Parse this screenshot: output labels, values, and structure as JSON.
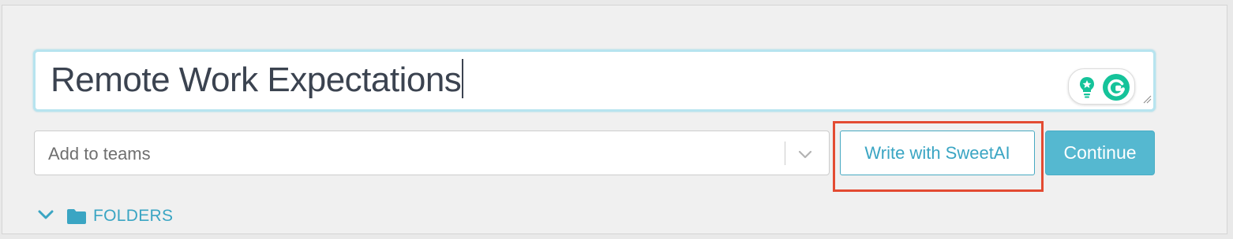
{
  "title_field": {
    "value": "Remote Work Expectations"
  },
  "grammarly": {
    "icons": [
      "lightbulb-icon",
      "grammarly-g-icon"
    ],
    "accent": "#15c39a"
  },
  "teams_select": {
    "placeholder": "Add to teams"
  },
  "actions": {
    "write_with_ai_label": "Write with SweetAI",
    "continue_label": "Continue"
  },
  "folders": {
    "label": "FOLDERS",
    "expanded": true
  },
  "colors": {
    "accent": "#3aa5c3",
    "continue_bg": "#55b8d0",
    "highlight": "#e34b32",
    "title_text": "#3b4350"
  }
}
